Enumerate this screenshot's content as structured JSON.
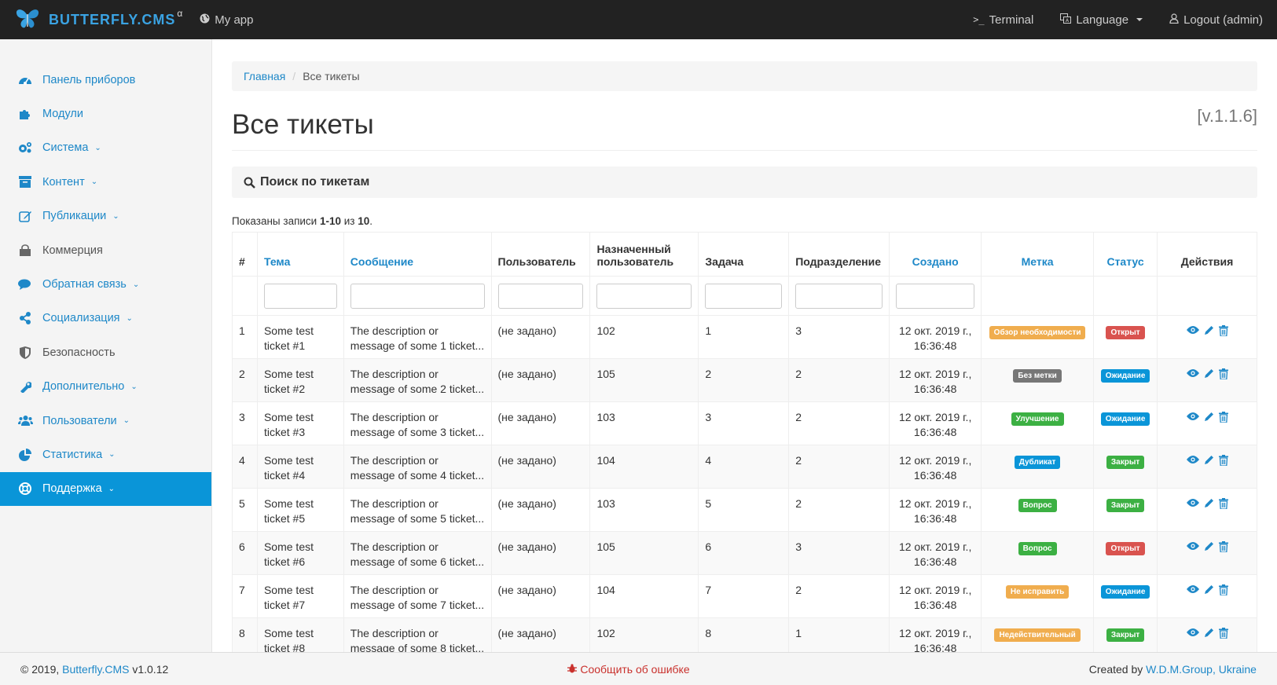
{
  "navbar": {
    "brand": "BUTTERFLY.CMS",
    "brand_sup": "α",
    "app_link": "My app",
    "terminal": "Terminal",
    "language": "Language",
    "logout": "Logout (admin)"
  },
  "sidebar": {
    "items": [
      {
        "label": "Панель приборов",
        "icon": "dashboard-icon"
      },
      {
        "label": "Модули",
        "icon": "puzzle-icon"
      },
      {
        "label": "Система",
        "icon": "cogs-icon"
      },
      {
        "label": "Контент",
        "icon": "archive-icon"
      },
      {
        "label": "Публикации",
        "icon": "edit-icon"
      },
      {
        "label": "Коммерция",
        "icon": "shopping-bag-icon"
      },
      {
        "label": "Обратная связь",
        "icon": "comments-icon"
      },
      {
        "label": "Социализация",
        "icon": "share-icon"
      },
      {
        "label": "Безопасность",
        "icon": "shield-icon"
      },
      {
        "label": "Дополнительно",
        "icon": "wrench-icon"
      },
      {
        "label": "Пользователи",
        "icon": "users-icon"
      },
      {
        "label": "Статистика",
        "icon": "pie-chart-icon"
      },
      {
        "label": "Поддержка",
        "icon": "life-ring-icon"
      }
    ]
  },
  "breadcrumb": {
    "home": "Главная",
    "current": "Все тикеты"
  },
  "page": {
    "title": "Все тикеты",
    "version": "[v.1.1.6]"
  },
  "search_panel": {
    "title": "Поиск по тикетам"
  },
  "summary": {
    "prefix": "Показаны записи ",
    "range": "1-10",
    "middle": " из ",
    "total": "10",
    "suffix": "."
  },
  "table": {
    "headers": {
      "num": "#",
      "subject": "Тема",
      "message": "Сообщение",
      "user": "Пользователь",
      "assigned": "Назначенный пользователь",
      "task": "Задача",
      "department": "Подразделение",
      "created": "Создано",
      "label": "Метка",
      "status": "Статус",
      "actions": "Действия"
    },
    "rows": [
      {
        "num": "1",
        "subject": "Some test ticket #1",
        "message": "The description or message of some 1 ticket...",
        "user": "(не задано)",
        "assigned": "102",
        "task": "1",
        "department": "3",
        "created": "12 окт. 2019 г., 16:36:48",
        "label": "Обзор необходимости",
        "label_color": "#f0ad4e",
        "status": "Открыт",
        "status_color": "#d9534f"
      },
      {
        "num": "2",
        "subject": "Some test ticket #2",
        "message": "The description or message of some 2 ticket...",
        "user": "(не задано)",
        "assigned": "105",
        "task": "2",
        "department": "2",
        "created": "12 окт. 2019 г., 16:36:48",
        "label": "Без метки",
        "label_color": "#777777",
        "status": "Ожидание",
        "status_color": "#0a95d8"
      },
      {
        "num": "3",
        "subject": "Some test ticket #3",
        "message": "The description or message of some 3 ticket...",
        "user": "(не задано)",
        "assigned": "103",
        "task": "3",
        "department": "2",
        "created": "12 окт. 2019 г., 16:36:48",
        "label": "Улучшение",
        "label_color": "#3cb043",
        "status": "Ожидание",
        "status_color": "#0a95d8"
      },
      {
        "num": "4",
        "subject": "Some test ticket #4",
        "message": "The description or message of some 4 ticket...",
        "user": "(не задано)",
        "assigned": "104",
        "task": "4",
        "department": "2",
        "created": "12 окт. 2019 г., 16:36:48",
        "label": "Дубликат",
        "label_color": "#0a95d8",
        "status": "Закрыт",
        "status_color": "#3cb043"
      },
      {
        "num": "5",
        "subject": "Some test ticket #5",
        "message": "The description or message of some 5 ticket...",
        "user": "(не задано)",
        "assigned": "103",
        "task": "5",
        "department": "2",
        "created": "12 окт. 2019 г., 16:36:48",
        "label": "Вопрос",
        "label_color": "#3cb043",
        "status": "Закрыт",
        "status_color": "#3cb043"
      },
      {
        "num": "6",
        "subject": "Some test ticket #6",
        "message": "The description or message of some 6 ticket...",
        "user": "(не задано)",
        "assigned": "105",
        "task": "6",
        "department": "3",
        "created": "12 окт. 2019 г., 16:36:48",
        "label": "Вопрос",
        "label_color": "#3cb043",
        "status": "Открыт",
        "status_color": "#d9534f"
      },
      {
        "num": "7",
        "subject": "Some test ticket #7",
        "message": "The description or message of some 7 ticket...",
        "user": "(не задано)",
        "assigned": "104",
        "task": "7",
        "department": "2",
        "created": "12 окт. 2019 г., 16:36:48",
        "label": "Не исправить",
        "label_color": "#f0ad4e",
        "status": "Ожидание",
        "status_color": "#0a95d8"
      },
      {
        "num": "8",
        "subject": "Some test ticket #8",
        "message": "The description or message of some 8 ticket...",
        "user": "(не задано)",
        "assigned": "102",
        "task": "8",
        "department": "1",
        "created": "12 окт. 2019 г., 16:36:48",
        "label": "Недействительный",
        "label_color": "#f0ad4e",
        "status": "Закрыт",
        "status_color": "#3cb043"
      }
    ]
  },
  "footer": {
    "copyright_prefix": "© 2019, ",
    "copyright_link": "Butterfly.CMS",
    "copyright_suffix": " v1.0.12",
    "bug_report": "Сообщить об ошибке",
    "created_prefix": "Created by ",
    "created_link": "W.D.M.Group, Ukraine"
  },
  "colors": {
    "accent": "#1e88c8",
    "active": "#0a95d8",
    "navbar": "#222222"
  }
}
